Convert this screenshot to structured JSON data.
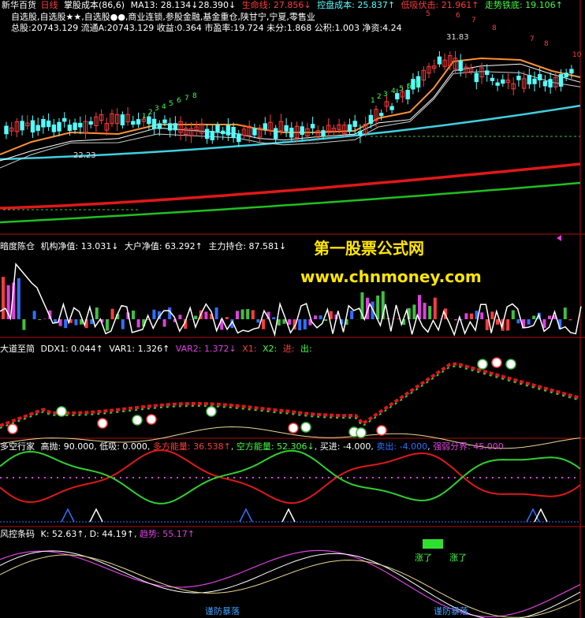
{
  "main_panel": {
    "stock_name": "新华百货",
    "period": "日线",
    "indicator_name": "掌股成本",
    "indicator_params": "(86,6)",
    "ma13": "MA13: 28.134↓",
    "ma_val2": "28.390↓",
    "life_line": "生命线: 27.856↓",
    "control_cost": "控盘成本: 25.837↑",
    "low_buy": "低吸伏击: 21.961↑",
    "trend_support": "走势铁底: 19.106↑",
    "selection_text": "自选股,自选股★★,自选股●●,商业连锁,参股金融,基金重仓,陕甘宁,宁夏,零售业",
    "fundamentals": "总股:20743.129 流通A:20743.129 收益:0.364 市盈率:19.724 未分:1.868 公积:1.003 净资:4.24",
    "high_label": "31.83",
    "low_label": "22.23"
  },
  "watermark": {
    "line1": "第一股票公式网",
    "line2": "www.chnmoney.com"
  },
  "panel2": {
    "name": "暗度陈仓",
    "inst_net": "机构净值: 13.031↓",
    "big_net": "大户净值: 63.292↑",
    "main_hold": "主力持仓: 87.581↓"
  },
  "panel3": {
    "name": "大道至简",
    "ddx1": "DDX1: 0.044↑",
    "var1": "VAR1: 1.326↑",
    "var2": "VAR2: 1.372↓",
    "x1": "X1:",
    "x2": "X2:",
    "jin": "进:",
    "chu": "出:"
  },
  "panel4": {
    "name": "多空行家",
    "high_sell": "高抛: 90.000",
    "low_buy": "低吸: 0.000",
    "bull_energy": "多方能量: 36.538↑",
    "bear_energy": "空方能量: 52.306↓",
    "buy_in": "买进: -4.000",
    "sell_out": "卖出: -4.000",
    "strength_line": "强弱分界: 45.000"
  },
  "panel5": {
    "name": "风控条码",
    "k": "K: 52.63↑",
    "d": "D: 44.19↑",
    "trend": "趋势: 55.17↑",
    "label_bottom": "谨防暴落",
    "label_bottom2": "谨防暴落",
    "label_rise1": "涨了",
    "label_rise2": "涨了"
  },
  "colors": {
    "up": "#ff3c3c",
    "down": "#54ffff",
    "cyan_line": "#40d0e0",
    "red_line": "#e01818",
    "green_line": "#20c020",
    "orange_line": "#ff9030",
    "white": "#ffffff",
    "yellow": "#ffe600",
    "magenta": "#e040e0",
    "blue": "#3070ff",
    "separator": "#b01010"
  },
  "chart_data": [
    {
      "type": "line",
      "title": "掌股成本(86,6)",
      "series": [
        {
          "name": "MA13",
          "values": [
            28.134
          ]
        },
        {
          "name": "生命线",
          "values": [
            27.856
          ]
        },
        {
          "name": "控盘成本",
          "values": [
            25.837
          ]
        },
        {
          "name": "低吸伏击",
          "values": [
            21.961
          ]
        },
        {
          "name": "走势铁底",
          "values": [
            19.106
          ]
        }
      ],
      "annotations": [
        "31.83",
        "22.23"
      ]
    },
    {
      "type": "bar",
      "title": "暗度陈仓",
      "series": [
        {
          "name": "机构净值",
          "values": [
            13.031
          ]
        },
        {
          "name": "大户净值",
          "values": [
            63.292
          ]
        },
        {
          "name": "主力持仓",
          "values": [
            87.581
          ]
        }
      ]
    },
    {
      "type": "line",
      "title": "大道至简",
      "series": [
        {
          "name": "DDX1",
          "values": [
            0.044
          ]
        },
        {
          "name": "VAR1",
          "values": [
            1.326
          ]
        },
        {
          "name": "VAR2",
          "values": [
            1.372
          ]
        }
      ]
    },
    {
      "type": "line",
      "title": "多空行家",
      "series": [
        {
          "name": "高抛",
          "values": [
            90.0
          ]
        },
        {
          "name": "低吸",
          "values": [
            0.0
          ]
        },
        {
          "name": "多方能量",
          "values": [
            36.538
          ]
        },
        {
          "name": "空方能量",
          "values": [
            52.306
          ]
        },
        {
          "name": "买进",
          "values": [
            -4.0
          ]
        },
        {
          "name": "卖出",
          "values": [
            -4.0
          ]
        },
        {
          "name": "强弱分界",
          "values": [
            45.0
          ]
        }
      ]
    },
    {
      "type": "line",
      "title": "风控条码",
      "series": [
        {
          "name": "K",
          "values": [
            52.63
          ]
        },
        {
          "name": "D",
          "values": [
            44.19
          ]
        },
        {
          "name": "趋势",
          "values": [
            55.17
          ]
        }
      ]
    }
  ]
}
